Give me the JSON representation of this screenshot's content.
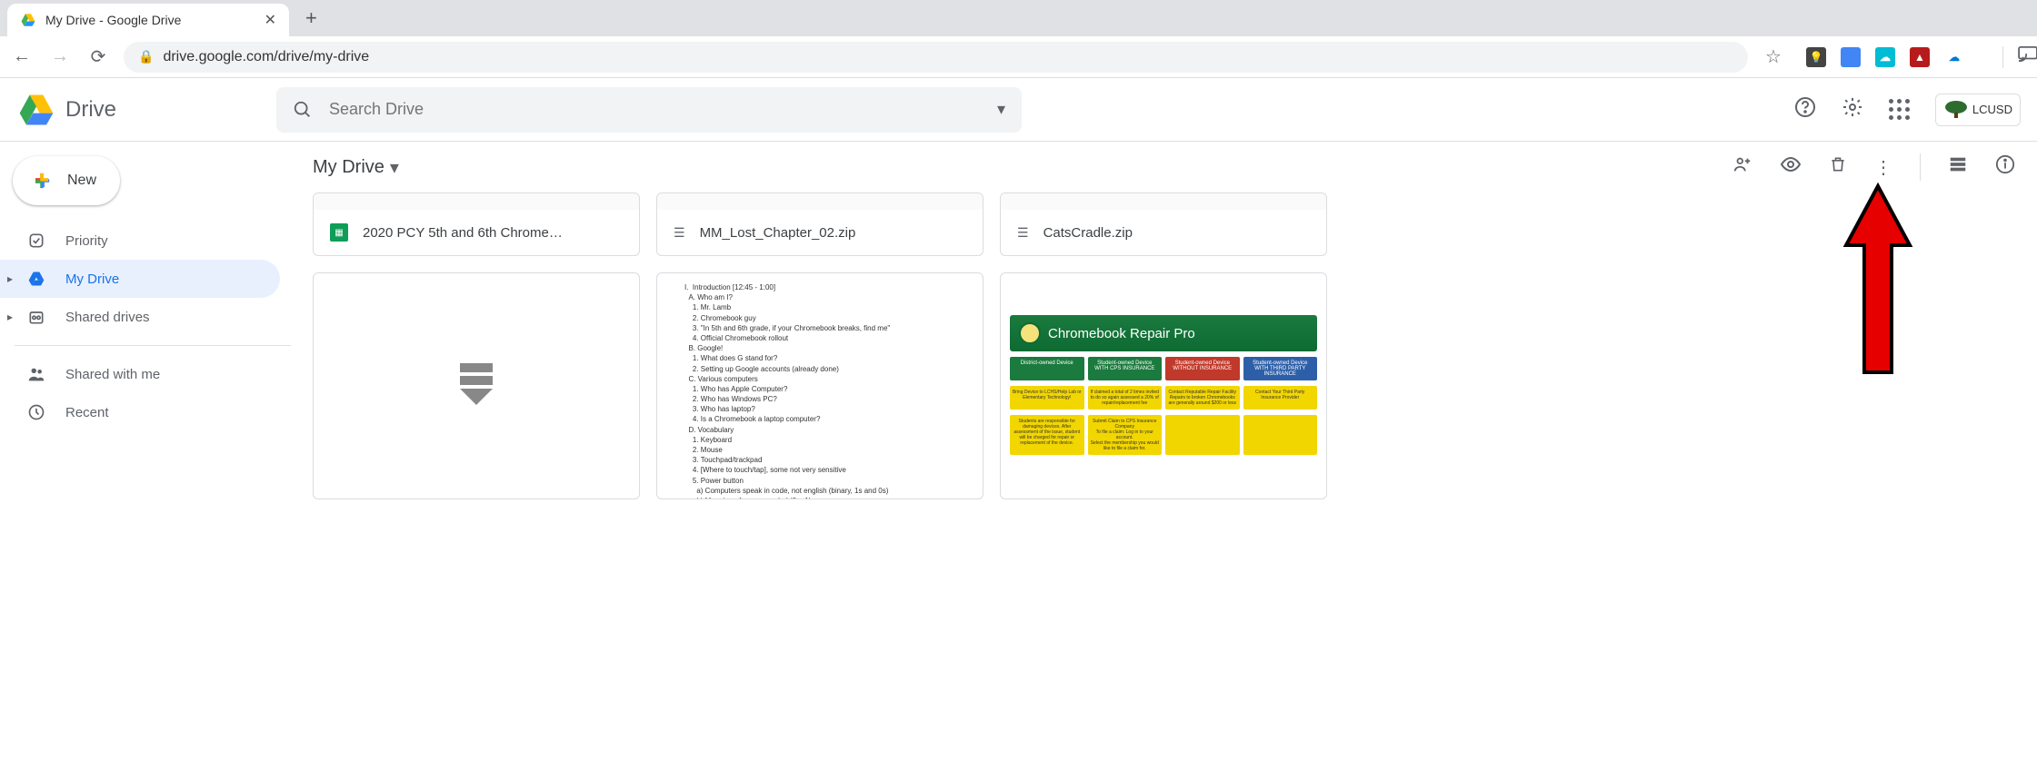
{
  "browser": {
    "tab_title": "My Drive - Google Drive",
    "url": "drive.google.com/drive/my-drive"
  },
  "header": {
    "product_name": "Drive",
    "search_placeholder": "Search Drive",
    "org_label": "LCUSD"
  },
  "sidebar": {
    "new_label": "New",
    "items": [
      {
        "label": "Priority"
      },
      {
        "label": "My Drive"
      },
      {
        "label": "Shared drives"
      },
      {
        "label": "Shared with me"
      },
      {
        "label": "Recent"
      }
    ]
  },
  "content": {
    "breadcrumb": "My Drive",
    "files": [
      {
        "name": "2020 PCY 5th and 6th Chrome…",
        "type": "sheet"
      },
      {
        "name": "MM_Lost_Chapter_02.zip",
        "type": "zip"
      },
      {
        "name": "CatsCradle.zip",
        "type": "zip"
      }
    ],
    "repair": {
      "title": "Chromebook Repair Pro",
      "tiles_top": [
        "District-owned Device",
        "Student-owned Device",
        "Student-owned Device",
        "Student-owned Device"
      ],
      "tiles_top_sub": [
        "",
        "WITH CPS INSURANCE",
        "WITHOUT INSURANCE",
        "WITH THIRD PARTY INSURANCE"
      ]
    }
  }
}
